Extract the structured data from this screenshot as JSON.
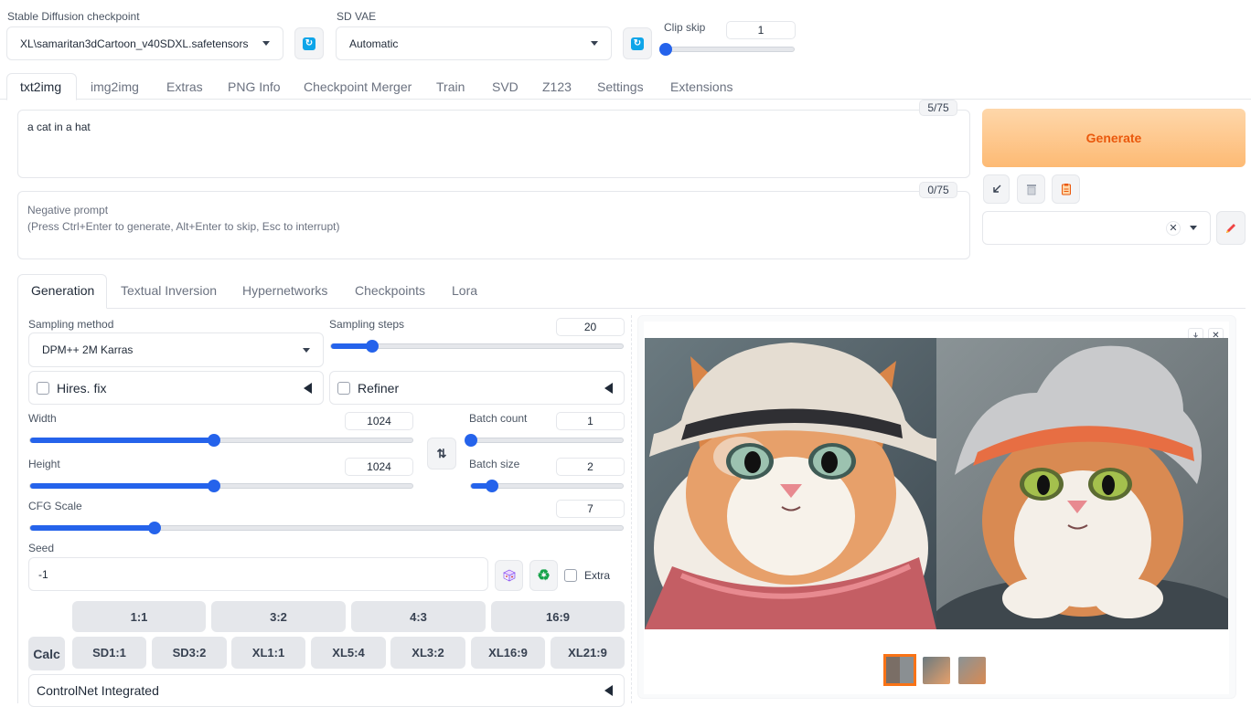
{
  "header": {
    "checkpoint_label": "Stable Diffusion checkpoint",
    "checkpoint_value": "XL\\samaritan3dCartoon_v40SDXL.safetensors",
    "vae_label": "SD VAE",
    "vae_value": "Automatic",
    "clip_skip_label": "Clip skip",
    "clip_skip_value": "1",
    "clip_skip_fraction": 0.0
  },
  "main_tabs": [
    "txt2img",
    "img2img",
    "Extras",
    "PNG Info",
    "Checkpoint Merger",
    "Train",
    "SVD",
    "Z123",
    "Settings",
    "Extensions"
  ],
  "prompt": {
    "text": "a cat in a hat",
    "counter": "5/75",
    "negative_placeholder": "Negative prompt\n(Press Ctrl+Enter to generate, Alt+Enter to skip, Esc to interrupt)",
    "negative_counter": "0/75"
  },
  "generate": {
    "label": "Generate"
  },
  "sub_tabs": [
    "Generation",
    "Textual Inversion",
    "Hypernetworks",
    "Checkpoints",
    "Lora"
  ],
  "generation": {
    "sampling_method_label": "Sampling method",
    "sampling_method_value": "DPM++ 2M Karras",
    "sampling_steps_label": "Sampling steps",
    "sampling_steps_value": "20",
    "sampling_steps_fraction": 0.14,
    "hires_label": "Hires. fix",
    "refiner_label": "Refiner",
    "width_label": "Width",
    "width_value": "1024",
    "width_fraction": 0.48,
    "height_label": "Height",
    "height_value": "1024",
    "height_fraction": 0.48,
    "batch_count_label": "Batch count",
    "batch_count_value": "1",
    "batch_count_fraction": 0.0,
    "batch_size_label": "Batch size",
    "batch_size_value": "2",
    "batch_size_fraction": 0.14,
    "cfg_label": "CFG Scale",
    "cfg_value": "7",
    "cfg_fraction": 0.21,
    "seed_label": "Seed",
    "seed_value": "-1",
    "extra_label": "Extra"
  },
  "aspect_ratios": [
    "1:1",
    "3:2",
    "4:3",
    "16:9"
  ],
  "calc_label": "Calc",
  "presets": [
    "SD1:1",
    "SD3:2",
    "XL1:1",
    "XL5:4",
    "XL3:2",
    "XL16:9",
    "XL21:9"
  ],
  "controlnet_label": "ControlNet Integrated",
  "icons": {
    "refresh": "refresh-icon",
    "swap": "swap-icon",
    "dice": "dice-icon",
    "recycle": "recycle-icon",
    "arrow": "arrow-down-left-icon",
    "trash": "trash-icon",
    "clipboard": "clipboard-icon",
    "pencil": "pencil-icon",
    "download": "download-icon",
    "close": "close-icon"
  },
  "colors": {
    "accent": "#2563eb",
    "generate_text": "#ea580c",
    "generate_bg": "#fdba74",
    "selected_thumb": "#f97316"
  }
}
